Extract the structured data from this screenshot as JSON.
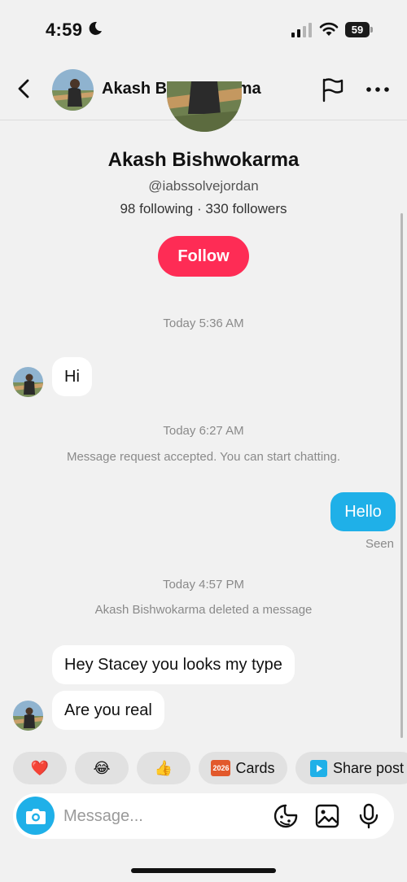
{
  "status_bar": {
    "time": "4:59",
    "battery": "59"
  },
  "header": {
    "name": "Akash Bishwokarma"
  },
  "profile": {
    "name": "Akash Bishwokarma",
    "handle": "@iabssolvejordan",
    "stats": "98 following · 330 followers",
    "follow_label": "Follow"
  },
  "messages": {
    "ts1": "Today 5:36 AM",
    "hi": "Hi",
    "ts2": "Today 6:27 AM",
    "request_accepted": "Message request accepted. You can start chatting.",
    "hello": "Hello",
    "seen": "Seen",
    "ts3": "Today 4:57 PM",
    "deleted": "Akash Bishwokarma deleted a message",
    "hey": "Hey Stacey you looks my type",
    "real": "Are you real"
  },
  "quick_replies": {
    "heart": "❤️",
    "laugh": "😂",
    "thumbs": "👍",
    "cards_badge": "2026",
    "cards": "Cards",
    "share_post": "Share post"
  },
  "composer": {
    "placeholder": "Message..."
  },
  "colors": {
    "accent": "#fe2c55",
    "outgoing_bubble": "#1fb0e8",
    "background": "#f1f1f1"
  },
  "icons": [
    "moon-icon",
    "signal-icon",
    "wifi-icon",
    "back-icon",
    "flag-icon",
    "more-icon",
    "camera-icon",
    "sticker-icon",
    "image-icon",
    "mic-icon",
    "play-icon"
  ]
}
